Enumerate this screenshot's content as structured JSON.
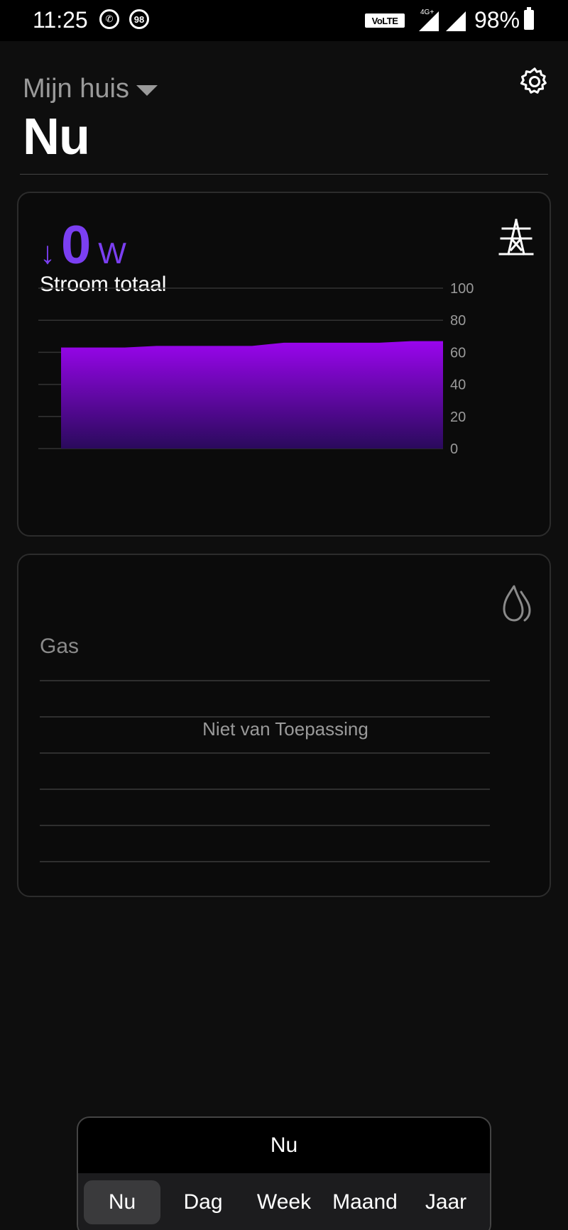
{
  "status_bar": {
    "time": "11:25",
    "notif_badge": "98",
    "volte": "VoLTE",
    "network": "4G+",
    "battery": "98%"
  },
  "header": {
    "home_name": "Mijn huis",
    "title": "Nu"
  },
  "power_card": {
    "arrow": "↓",
    "value": "0",
    "unit": "W",
    "label": "Stroom totaal",
    "accent_color": "#7b3ff2"
  },
  "chart_data": {
    "type": "area",
    "title": "",
    "xlabel": "",
    "ylabel": "",
    "ylim": [
      0,
      100
    ],
    "y_ticks": [
      "100",
      "80",
      "60",
      "40",
      "20",
      "0"
    ],
    "x": [
      0,
      1,
      2,
      3,
      4,
      5,
      6,
      7,
      8,
      9,
      10,
      11,
      12
    ],
    "values": [
      63,
      63,
      63,
      64,
      64,
      64,
      64,
      66,
      66,
      66,
      66,
      67,
      67
    ],
    "grid": true,
    "fill_top": "#9a05ee",
    "fill_bottom": "#2a0a5c"
  },
  "gas_card": {
    "label": "Gas",
    "message": "Niet van Toepassing"
  },
  "period_selector": {
    "current": "Nu",
    "tabs": [
      "Nu",
      "Dag",
      "Week",
      "Maand",
      "Jaar"
    ],
    "active_index": 0
  },
  "icons": {
    "settings": "gear-icon",
    "power": "power-pylon-icon",
    "gas": "flame-icon"
  }
}
